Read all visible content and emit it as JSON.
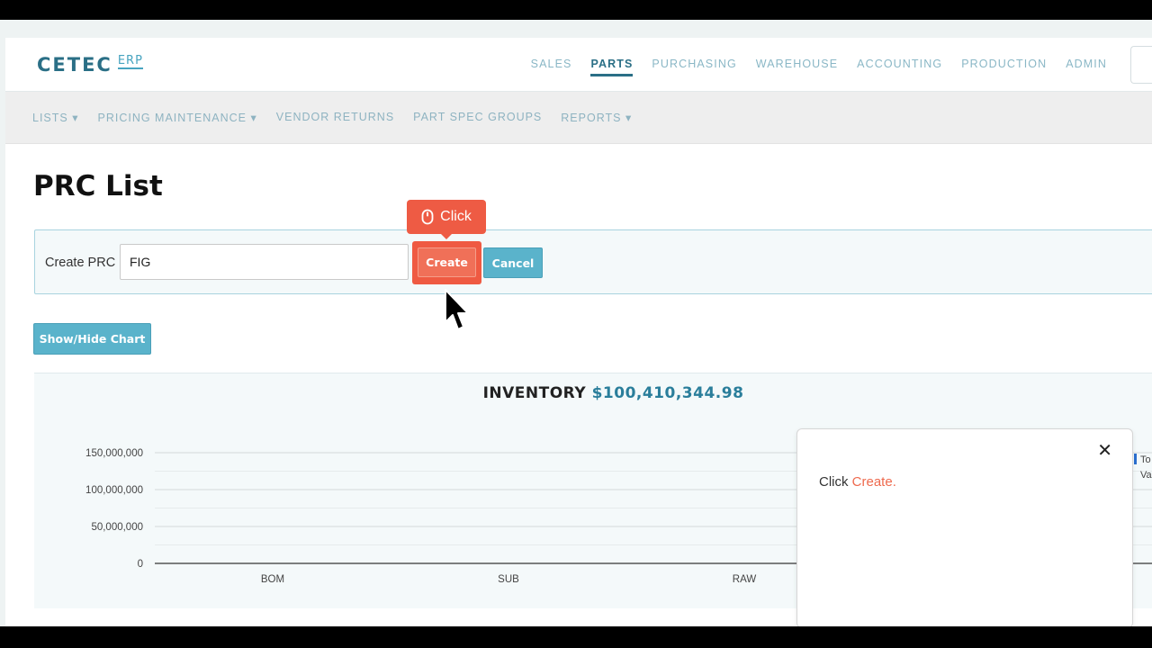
{
  "brand": {
    "name": "CETEC",
    "suffix": "ERP"
  },
  "topnav": {
    "items": [
      {
        "label": "SALES"
      },
      {
        "label": "PARTS"
      },
      {
        "label": "PURCHASING"
      },
      {
        "label": "WAREHOUSE"
      },
      {
        "label": "ACCOUNTING"
      },
      {
        "label": "PRODUCTION"
      },
      {
        "label": "ADMIN"
      }
    ],
    "active": "PARTS"
  },
  "subnav": {
    "items": [
      {
        "label": "LISTS ▾"
      },
      {
        "label": "PRICING MAINTENANCE ▾"
      },
      {
        "label": "VENDOR RETURNS"
      },
      {
        "label": "PART SPEC GROUPS"
      },
      {
        "label": "REPORTS ▾"
      }
    ]
  },
  "page": {
    "title": "PRC List"
  },
  "create_form": {
    "label": "Create PRC",
    "input_value": "FIG",
    "create_label": "Create",
    "cancel_label": "Cancel"
  },
  "tooltip": {
    "label": "Click",
    "icon": "mouse-icon"
  },
  "show_hide_label": "Show/Hide Chart",
  "chart_data": {
    "type": "bar",
    "title": "INVENTORY",
    "title_value": "$100,410,344.98",
    "categories": [
      "BOM",
      "SUB",
      "RAW"
    ],
    "y_ticks": [
      "150,000,000",
      "100,000,000",
      "50,000,000",
      "0"
    ],
    "ylim": [
      0,
      150000000
    ],
    "grid": true,
    "legend": {
      "placement": "right",
      "text_fragments": [
        "To",
        "Va"
      ]
    }
  },
  "popup": {
    "prefix": "Click ",
    "accent": "Create."
  },
  "colors": {
    "brand": "#2a6f86",
    "accent_orange": "#ee5b44",
    "button_teal": "#5ab3cb"
  }
}
